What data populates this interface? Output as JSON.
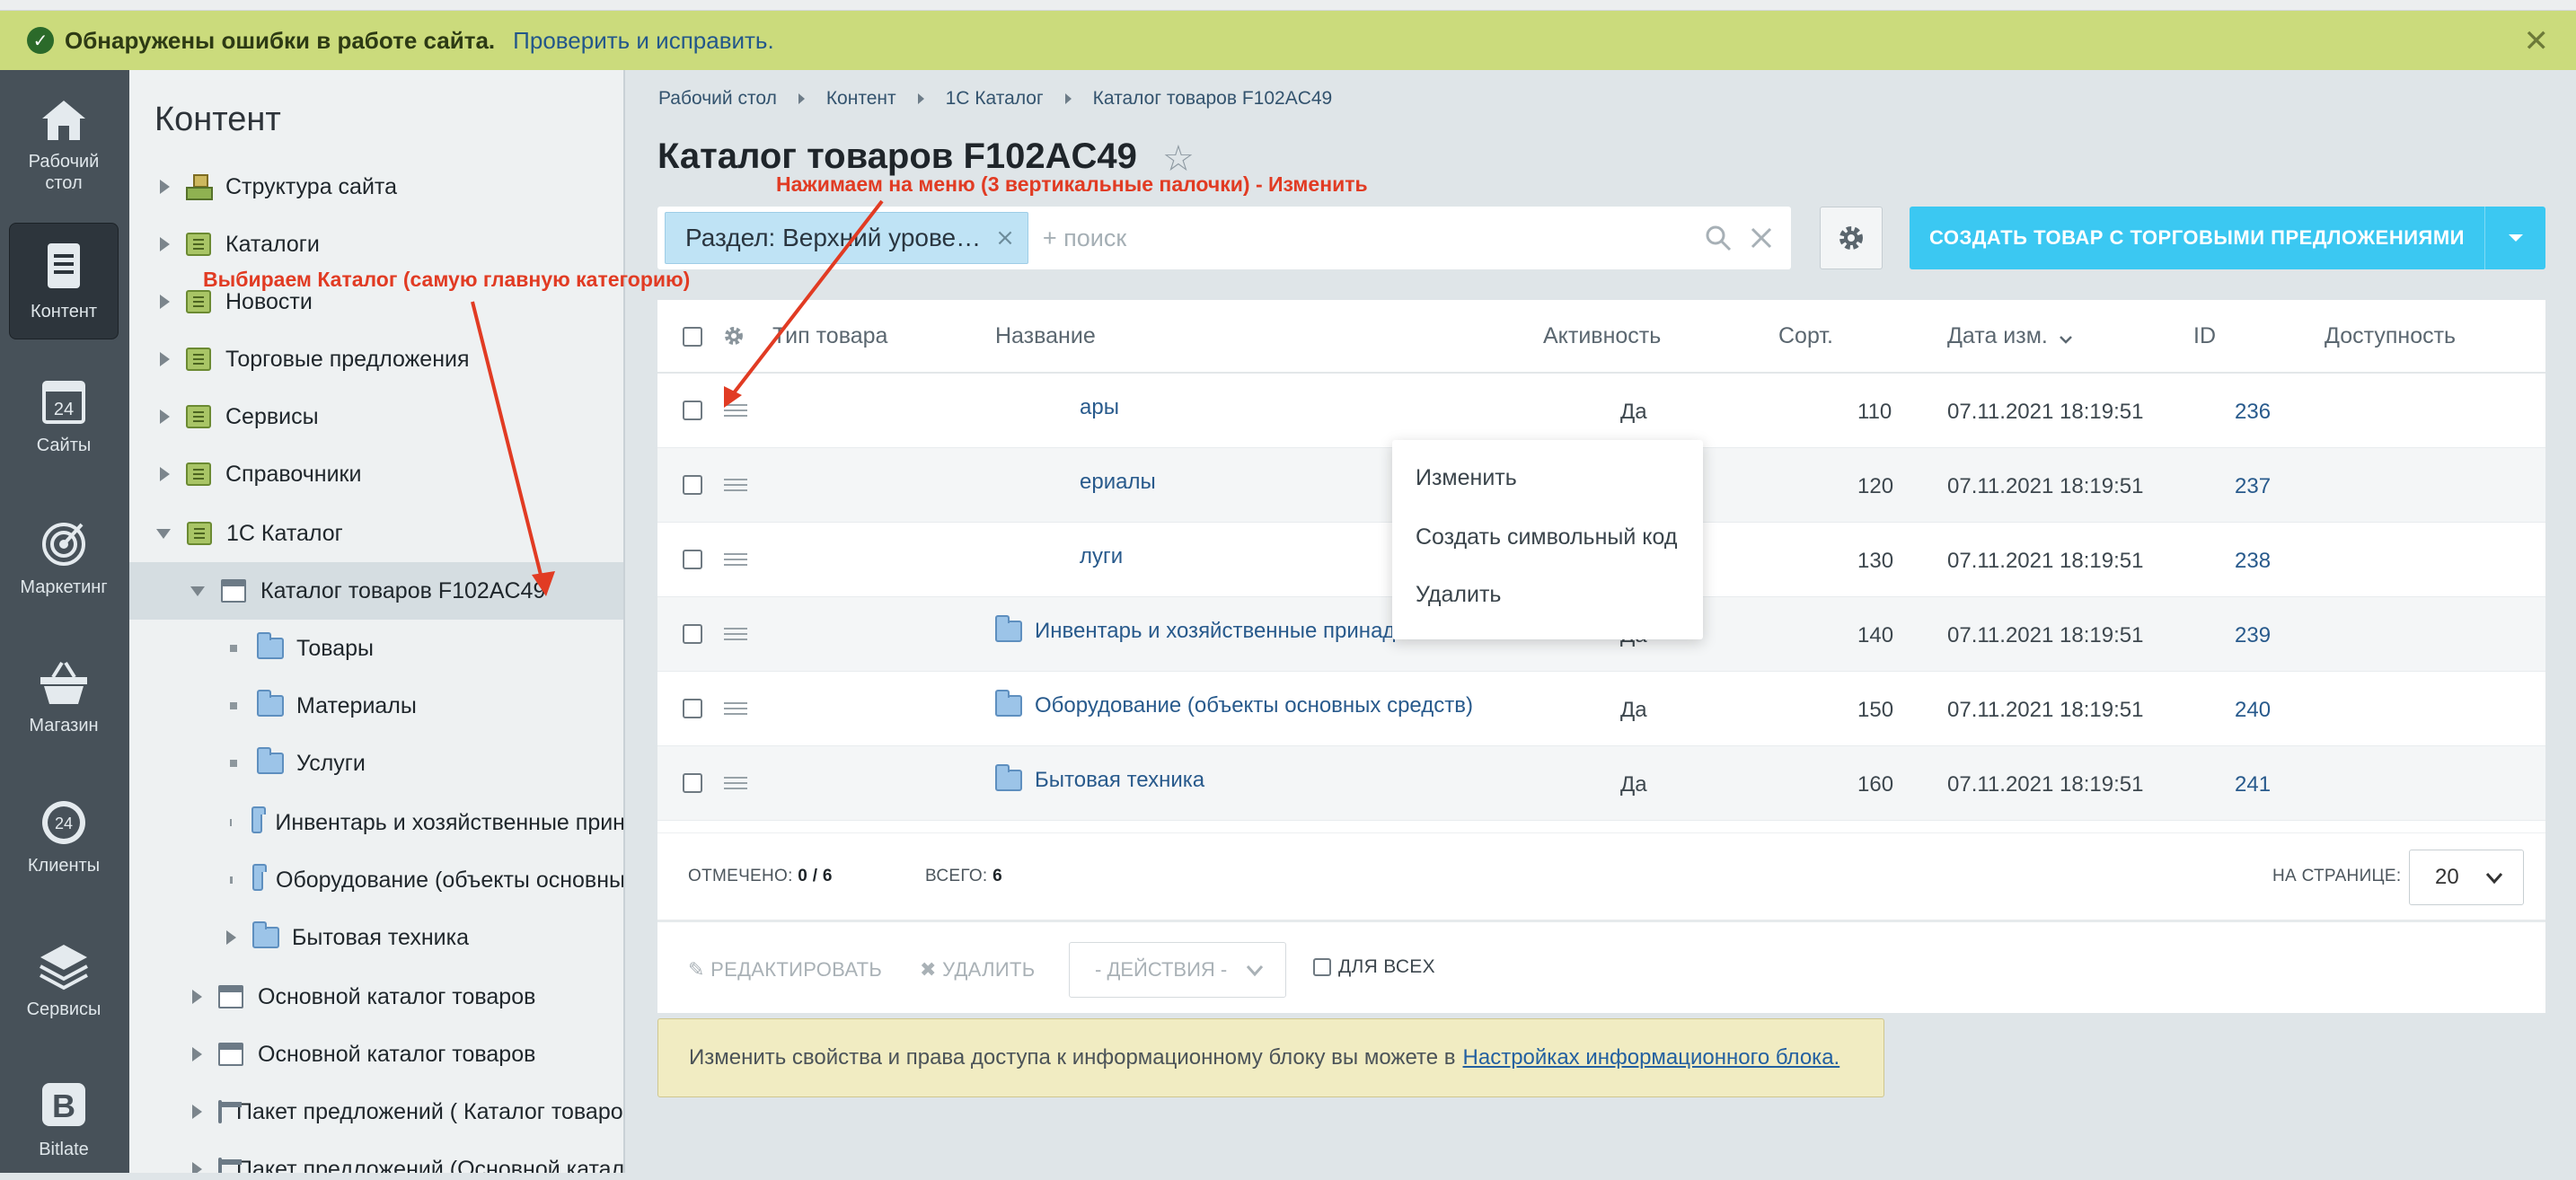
{
  "alert": {
    "message": "Обнаружены ошибки в работе сайта.",
    "link": "Проверить и исправить.",
    "close": "✕"
  },
  "leftbar": [
    {
      "label1": "Рабочий",
      "label2": "стол",
      "icon": "home-icon"
    },
    {
      "label1": "Контент",
      "label2": "",
      "icon": "document-icon"
    },
    {
      "label1": "Сайты",
      "label2": "",
      "icon": "calendar-icon"
    },
    {
      "label1": "Маркетинг",
      "label2": "",
      "icon": "target-icon"
    },
    {
      "label1": "Магазин",
      "label2": "",
      "icon": "basket-icon"
    },
    {
      "label1": "Клиенты",
      "label2": "",
      "icon": "clients-icon"
    },
    {
      "label1": "Сервисы",
      "label2": "",
      "icon": "layers-icon"
    },
    {
      "label1": "Bitlate",
      "label2": "",
      "icon": "b-logo-icon"
    }
  ],
  "sidebar": {
    "title": "Контент",
    "items": [
      {
        "label": "Структура сайта"
      },
      {
        "label": "Каталоги"
      },
      {
        "label": "Новости"
      },
      {
        "label": "Торговые предложения"
      },
      {
        "label": "Сервисы"
      },
      {
        "label": "Справочники"
      },
      {
        "label": "1С Каталог"
      },
      {
        "label": "Каталог товаров F102AC49"
      },
      {
        "label": "Товары"
      },
      {
        "label": "Материалы"
      },
      {
        "label": "Услуги"
      },
      {
        "label": "Инвентарь и хозяйственные прин"
      },
      {
        "label": "Оборудование (объекты основны"
      },
      {
        "label": "Бытовая техника"
      },
      {
        "label": "Основной каталог товаров"
      },
      {
        "label": "Основной каталог товаров"
      },
      {
        "label": "Пакет предложений ( Каталог товаров"
      },
      {
        "label": "Пакет предложений (Основной каталог"
      }
    ]
  },
  "breadcrumbs": [
    "Рабочий стол",
    "Контент",
    "1С Каталог",
    "Каталог товаров F102AC49"
  ],
  "page_title": "Каталог товаров F102AC49",
  "filter": {
    "tag": "Раздел: Верхний урове…",
    "placeholder": "+ поиск"
  },
  "create_button": "СОЗДАТЬ ТОВАР С ТОРГОВЫМИ ПРЕДЛОЖЕНИЯМИ",
  "columns": [
    "Тип товара",
    "Название",
    "Активность",
    "Сорт.",
    "Дата изм.",
    "ID",
    "Доступность"
  ],
  "rows": [
    {
      "name": "Товары",
      "name_visible": "ары",
      "active": "Да",
      "sort": "110",
      "date": "07.11.2021 18:19:51",
      "id": "236"
    },
    {
      "name": "Материалы",
      "name_visible": "ериалы",
      "active": "Да",
      "sort": "120",
      "date": "07.11.2021 18:19:51",
      "id": "237"
    },
    {
      "name": "Услуги",
      "name_visible": "луги",
      "active": "Да",
      "sort": "130",
      "date": "07.11.2021 18:19:51",
      "id": "238"
    },
    {
      "name": "Инвентарь и хозяйственные принадлежности",
      "name_visible": "Инвентарь и хозяйственные принадлежности",
      "active": "Да",
      "sort": "140",
      "date": "07.11.2021 18:19:51",
      "id": "239"
    },
    {
      "name": "Оборудование (объекты основных средств)",
      "name_visible": "Оборудование (объекты основных средств)",
      "active": "Да",
      "sort": "150",
      "date": "07.11.2021 18:19:51",
      "id": "240"
    },
    {
      "name": "Бытовая техника",
      "name_visible": "Бытовая техника",
      "active": "Да",
      "sort": "160",
      "date": "07.11.2021 18:19:51",
      "id": "241"
    }
  ],
  "context_menu": [
    "Изменить",
    "Создать символьный код",
    "Удалить"
  ],
  "footer": {
    "selected_label": "ОТМЕЧЕНО:",
    "selected_value": "0 / 6",
    "total_label": "ВСЕГО:",
    "total_value": "6",
    "per_page_label": "НА СТРАНИЦЕ:",
    "per_page_value": "20"
  },
  "actions": {
    "edit": "РЕДАКТИРОВАТЬ",
    "delete": "УДАЛИТЬ",
    "select": "- ДЕЙСТВИЯ -",
    "for_all": "ДЛЯ ВСЕХ"
  },
  "notice": {
    "text": "Изменить свойства и права доступа к информационному блоку вы можете в",
    "link": "Настройках информационного блока."
  },
  "annotations": {
    "menu_hint": "Нажимаем на меню (3 вертикальные палочки) - Изменить",
    "catalog_hint": "Выбираем  Каталог (самую главную категорию)"
  },
  "colors": {
    "alert_bg": "#cbdb7c",
    "accent_button": "#3bc8f2",
    "annotation": "#e13b23",
    "leftbar": "#475159"
  }
}
